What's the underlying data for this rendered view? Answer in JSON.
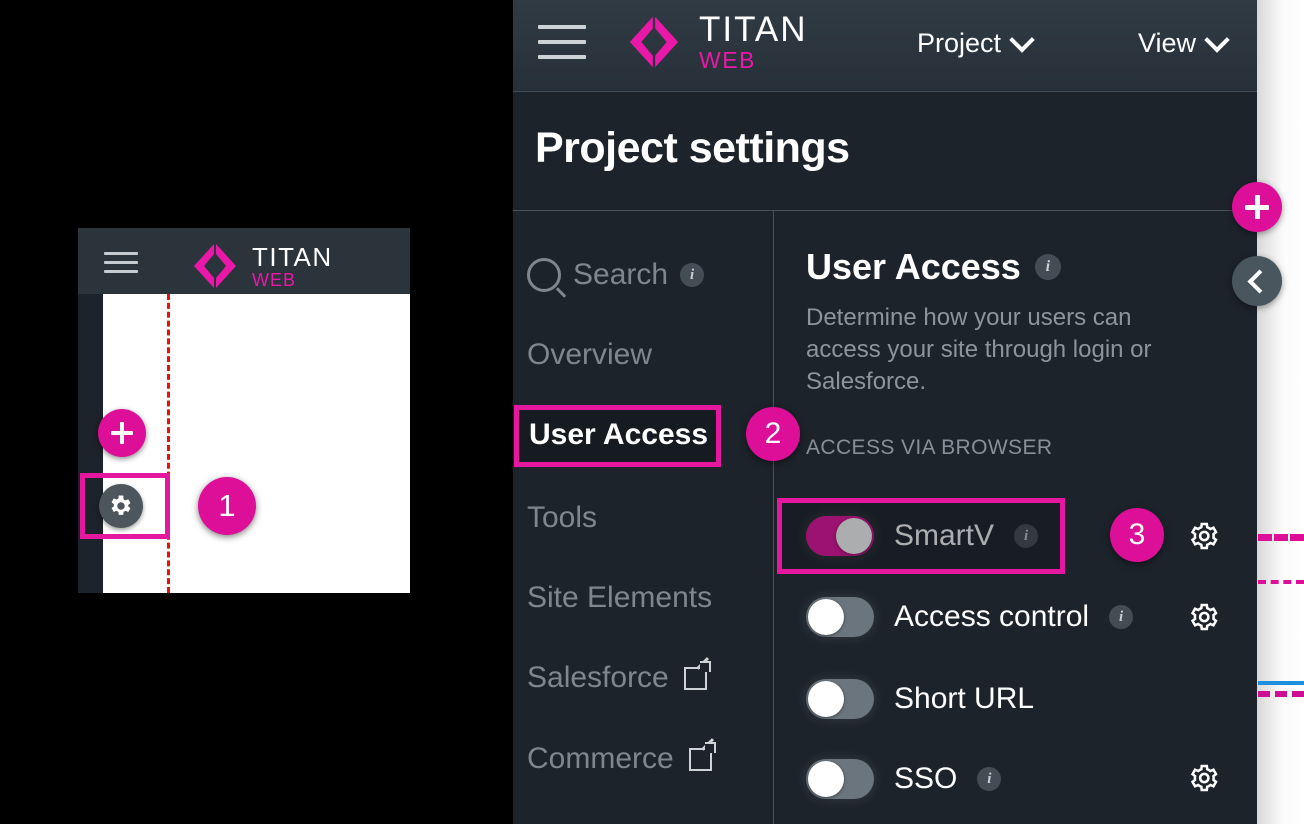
{
  "brand": {
    "name": "TITAN",
    "sub": "WEB",
    "logo_icon": "titan-diamond-logo"
  },
  "topbar": {
    "menu_icon": "hamburger-menu-icon",
    "menus": [
      {
        "label": "Project",
        "icon": "chevron-down-icon"
      },
      {
        "label": "View",
        "icon": "chevron-down-icon"
      }
    ]
  },
  "page": {
    "title": "Project settings"
  },
  "settings_nav": {
    "items": [
      {
        "label": "Search",
        "icon": "search-icon",
        "info": "i",
        "active": false
      },
      {
        "label": "Overview",
        "active": false
      },
      {
        "label": "User Access",
        "active": true
      },
      {
        "label": "Tools",
        "active": false
      },
      {
        "label": "Site Elements",
        "active": false
      },
      {
        "label": "Salesforce",
        "icon": "external-link-icon",
        "active": false
      },
      {
        "label": "Commerce",
        "icon": "external-link-icon",
        "active": false
      }
    ]
  },
  "user_access": {
    "heading": "User Access",
    "heading_info": "i",
    "description": "Determine how your users can access your site through login or Salesforce.",
    "section_label": "ACCESS VIA BROWSER",
    "toggles": [
      {
        "label": "SmartV",
        "state": "on",
        "info": "i",
        "gear": "gear-icon"
      },
      {
        "label": "Access control",
        "state": "off",
        "info": "i",
        "gear": "gear-icon"
      },
      {
        "label": "Short URL",
        "state": "off",
        "info": null,
        "gear": null
      },
      {
        "label": "SSO",
        "state": "off",
        "info": "i",
        "gear": "gear-icon"
      }
    ]
  },
  "floating_controls": {
    "add": {
      "icon": "plus-icon"
    },
    "collapse": {
      "icon": "chevron-left-icon"
    }
  },
  "mini_preview": {
    "brand": "TITAN",
    "brand_sub": "WEB",
    "menu_icon": "hamburger-menu-icon",
    "add_icon": "plus-icon",
    "settings_icon": "gear-icon"
  },
  "annotations": {
    "badges": [
      {
        "number": "1",
        "target": "mini-preview-settings-gear"
      },
      {
        "number": "2",
        "target": "nav-user-access"
      },
      {
        "number": "3",
        "target": "smartv-toggle"
      }
    ],
    "highlight_color": "#e5179f"
  },
  "colors": {
    "accent_magenta": "#dd0f99",
    "toggle_on": "#e5119e",
    "toggle_off": "#6b757d",
    "panel_bg": "#1d232b",
    "topbar_bg": "#2b333b",
    "muted_text": "#7e878f",
    "edge_blue": "#1e8fe0"
  }
}
